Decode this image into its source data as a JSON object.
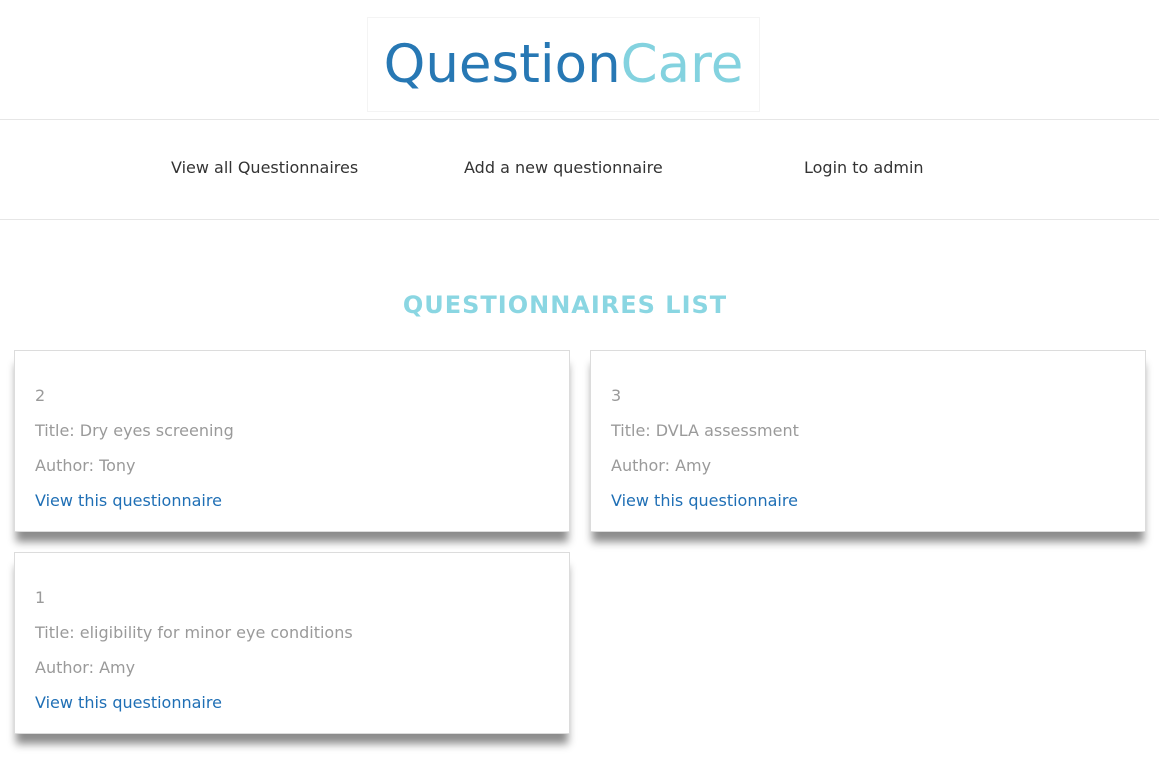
{
  "header": {
    "logo_part1": "Question",
    "logo_part2": "Care",
    "brand_dark": "#2778b4",
    "brand_light": "#83d2df"
  },
  "nav": {
    "items": [
      {
        "label": "View all Questionnaires"
      },
      {
        "label": "Add a new questionnaire"
      },
      {
        "label": "Login to admin"
      }
    ]
  },
  "main": {
    "heading": "QUESTIONNAIRES LIST",
    "cards": [
      {
        "id": "2",
        "title": "Title: Dry eyes screening",
        "author": "Author: Tony",
        "link": "View this questionnaire"
      },
      {
        "id": "3",
        "title": "Title: DVLA assessment",
        "author": "Author: Amy",
        "link": "View this questionnaire"
      },
      {
        "id": "1",
        "title": "Title: eligibility for minor eye conditions",
        "author": "Author: Amy",
        "link": "View this questionnaire"
      }
    ]
  }
}
